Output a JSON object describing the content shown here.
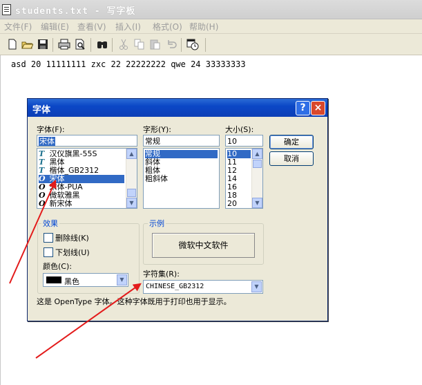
{
  "window": {
    "title": "students.txt - 写字板"
  },
  "menu": [
    "文件(F)",
    "编辑(E)",
    "查看(V)",
    "插入(I)",
    "格式(O)",
    "帮助(H)"
  ],
  "document": {
    "text": "asd 20 11111111 zxc 22 22222222 qwe 24 33333333"
  },
  "dialog": {
    "title": "字体",
    "help": "?",
    "close": "×",
    "font_label": "字体(F):",
    "font_value": "宋体",
    "font_list": [
      {
        "icon": "T",
        "name": "汉仪旗黑-55S"
      },
      {
        "icon": "T",
        "name": "黑体"
      },
      {
        "icon": "T",
        "name": "楷体_GB2312"
      },
      {
        "icon": "O",
        "name": "宋体"
      },
      {
        "icon": "O",
        "name": "宋体-PUA"
      },
      {
        "icon": "O",
        "name": "微软雅黑"
      },
      {
        "icon": "O",
        "name": "新宋体"
      }
    ],
    "style_label": "字形(Y):",
    "style_value": "常规",
    "style_list": [
      "常规",
      "斜体",
      "粗体",
      "粗斜体"
    ],
    "size_label": "大小(S):",
    "size_value": "10",
    "size_list": [
      "10",
      "11",
      "12",
      "14",
      "16",
      "18",
      "20"
    ],
    "ok": "确定",
    "cancel": "取消",
    "effects_title": "效果",
    "strikeout": "删除线(K)",
    "underline": "下划线(U)",
    "color_label": "颜色(C):",
    "color_value": "黑色",
    "sample_title": "示例",
    "sample_text": "微软中文软件",
    "charset_label": "字符集(R):",
    "charset_value": "CHINESE_GB2312",
    "info": "这是 OpenType 字体。这种字体既用于打印也用于显示。"
  },
  "colors": {
    "titlebar": "#0b47c6",
    "selection": "#316ac5",
    "arrow": "#e31b1b",
    "group_title": "#0046d5"
  }
}
